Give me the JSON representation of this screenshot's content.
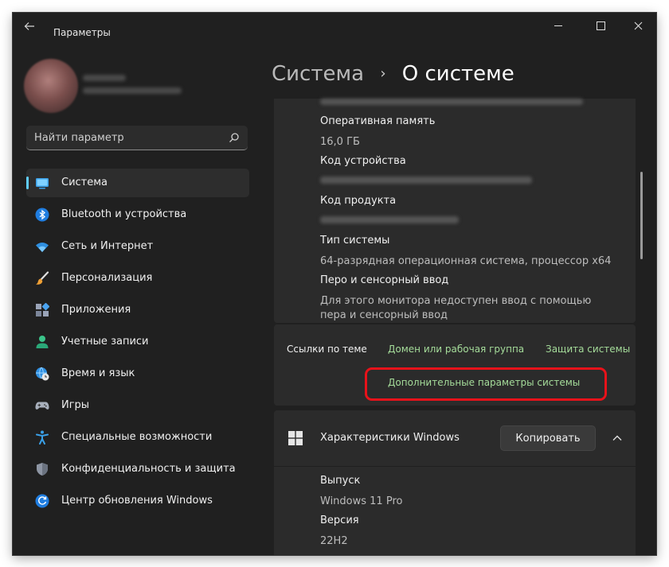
{
  "window": {
    "title": "Параметры"
  },
  "search": {
    "placeholder": "Найти параметр"
  },
  "nav": [
    {
      "label": "Система",
      "icon": "system-icon",
      "active": true
    },
    {
      "label": "Bluetooth и устройства",
      "icon": "bluetooth-icon"
    },
    {
      "label": "Сеть и Интернет",
      "icon": "wifi-icon"
    },
    {
      "label": "Персонализация",
      "icon": "brush-icon"
    },
    {
      "label": "Приложения",
      "icon": "apps-icon"
    },
    {
      "label": "Учетные записи",
      "icon": "account-icon"
    },
    {
      "label": "Время и язык",
      "icon": "globe-clock-icon"
    },
    {
      "label": "Игры",
      "icon": "gamepad-icon"
    },
    {
      "label": "Специальные возможности",
      "icon": "accessibility-icon"
    },
    {
      "label": "Конфиденциальность и защита",
      "icon": "shield-icon"
    },
    {
      "label": "Центр обновления Windows",
      "icon": "update-icon"
    }
  ],
  "breadcrumb": {
    "parent": "Система",
    "separator": "›",
    "current": "О системе"
  },
  "specs": {
    "ram_label": "Оперативная память",
    "ram_value": "16,0 ГБ",
    "device_id_label": "Код устройства",
    "product_id_label": "Код продукта",
    "system_type_label": "Тип системы",
    "system_type_value": "64-разрядная операционная система, процессор x64",
    "pen_label": "Перо и сенсорный ввод",
    "pen_value_line1": "Для этого монитора недоступен ввод с помощью",
    "pen_value_line2": "пера и сенсорный ввод"
  },
  "related_links": {
    "title": "Ссылки по теме",
    "domain": "Домен или рабочая группа",
    "protection": "Защита системы",
    "advanced": "Дополнительные параметры системы"
  },
  "windows_specs": {
    "title": "Характеристики Windows",
    "copy_button": "Копировать",
    "edition_label": "Выпуск",
    "edition_value": "Windows 11 Pro",
    "version_label": "Версия",
    "version_value": "22H2"
  },
  "colors": {
    "accent": "#60cdff",
    "link": "#a5dc9a",
    "highlight": "#e8121a",
    "background": "#202020",
    "card": "#2b2b2b"
  }
}
